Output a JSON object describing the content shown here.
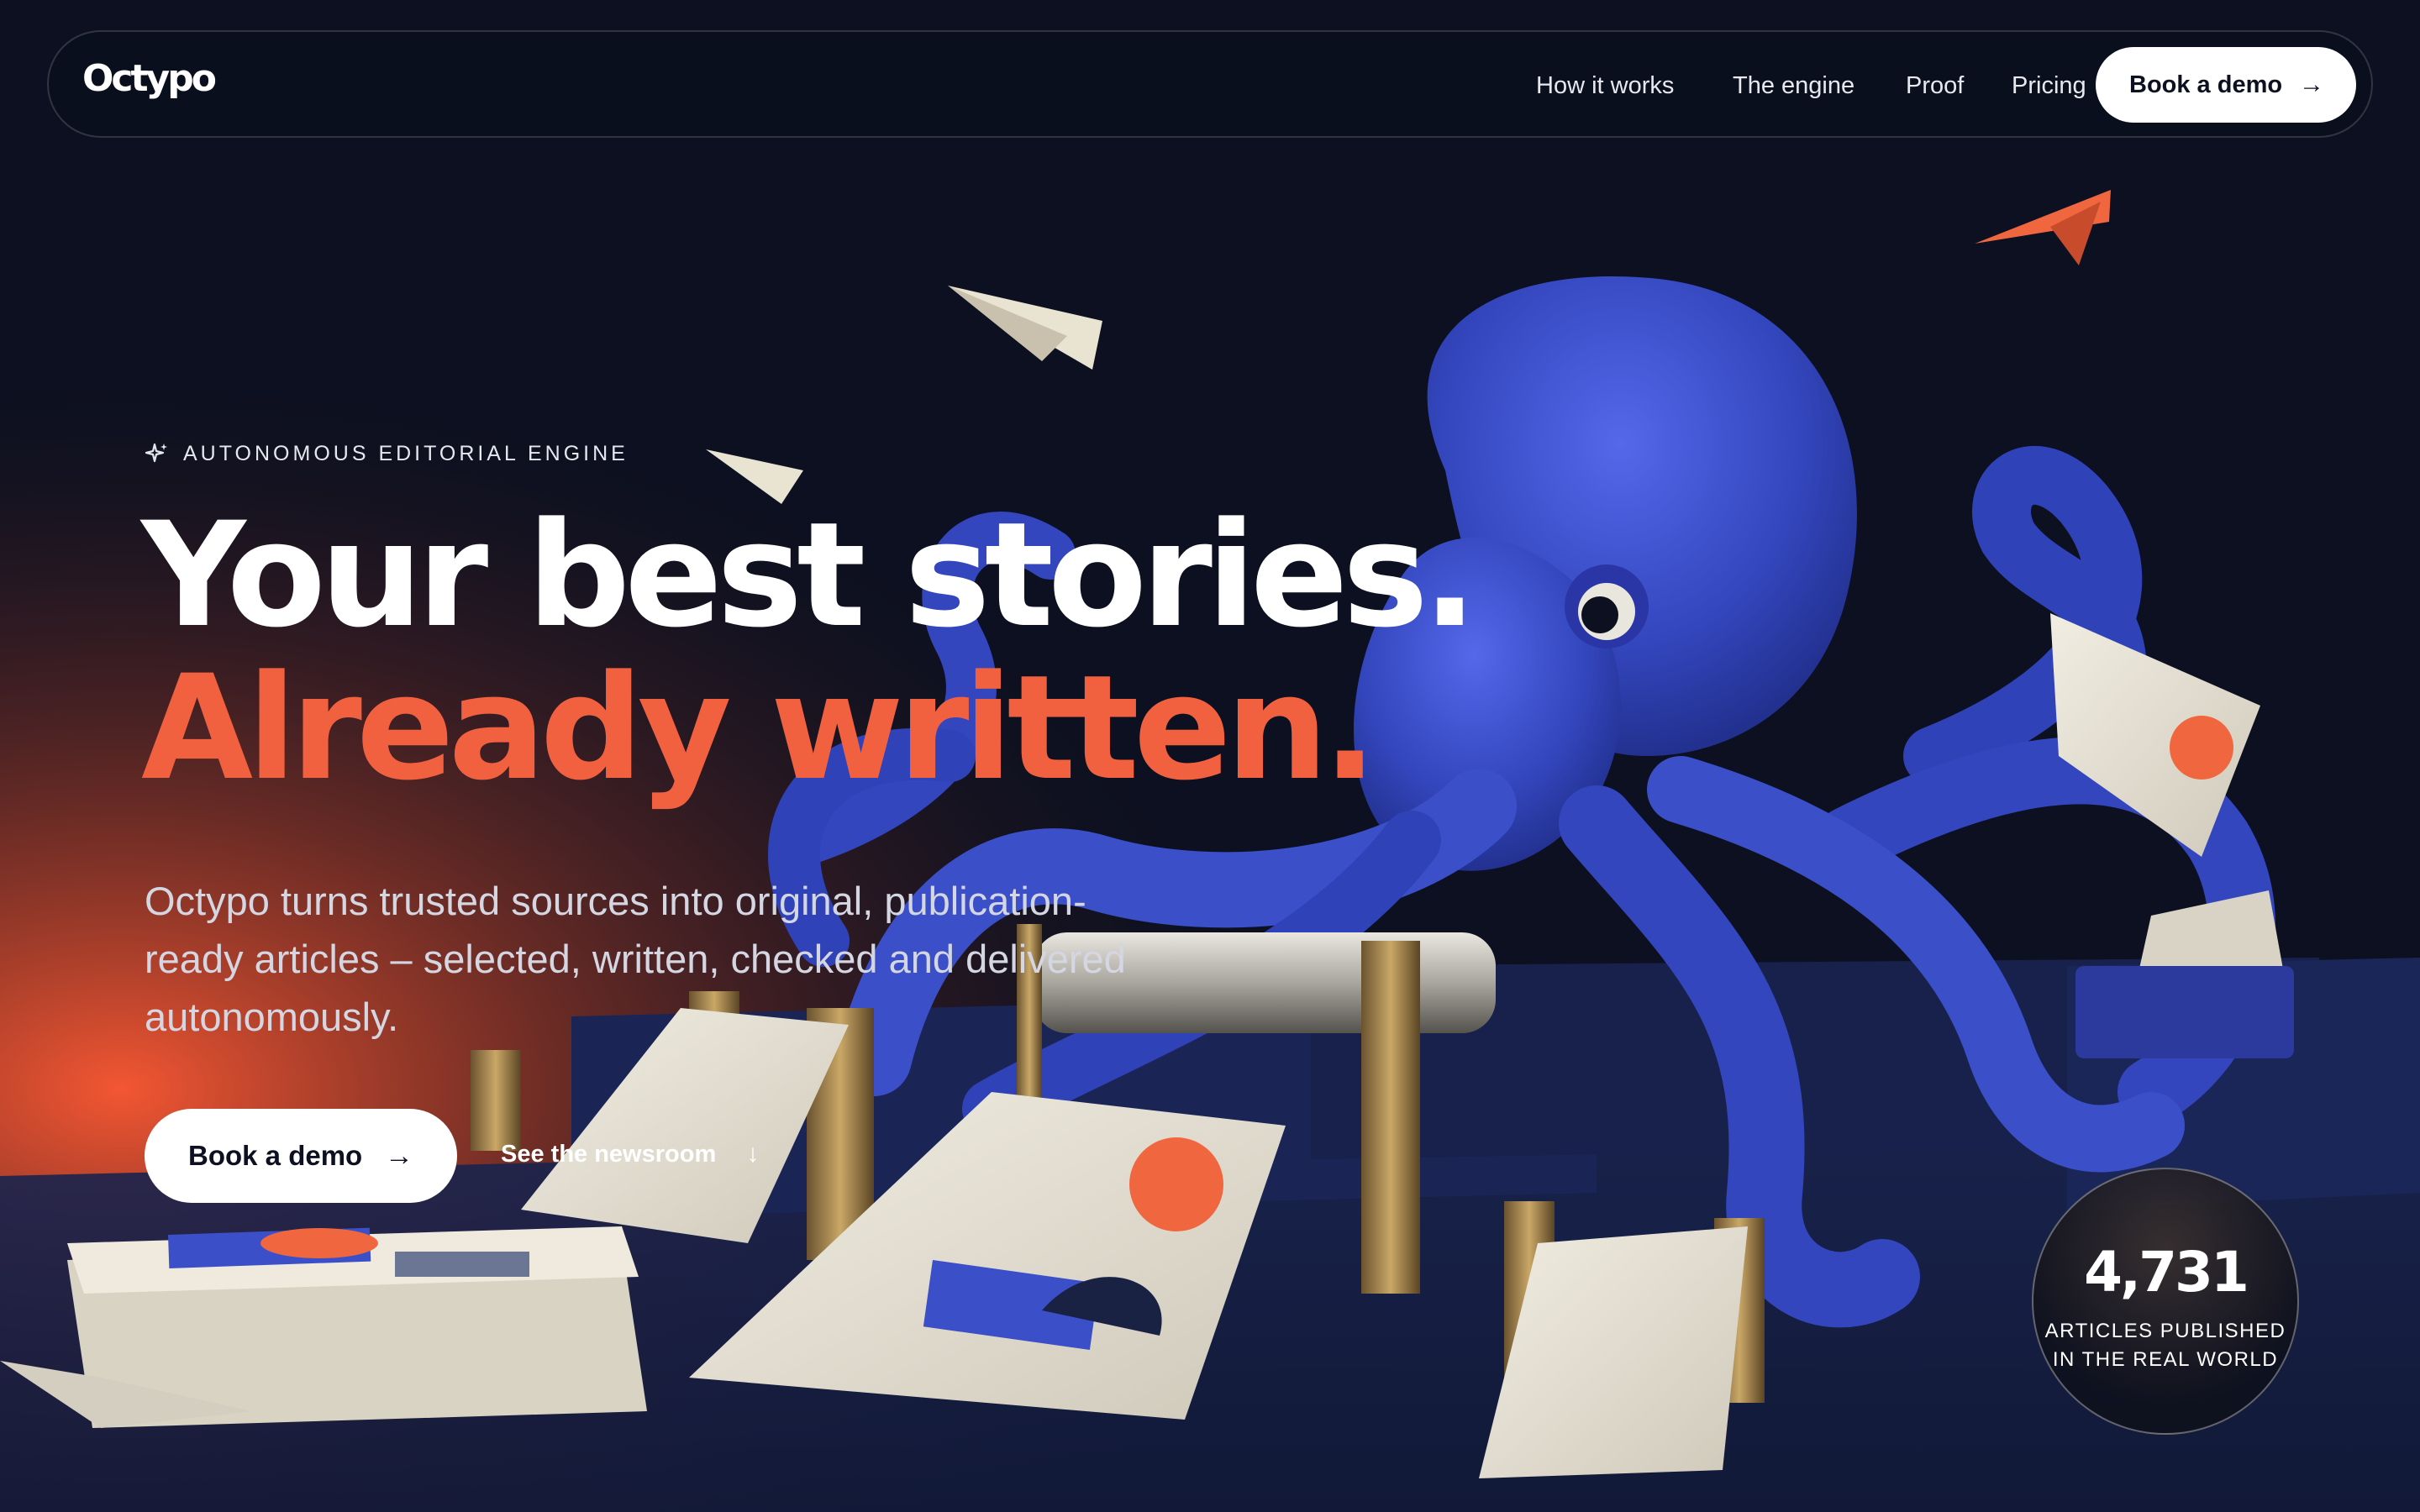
{
  "brand": {
    "logo": "Octypo"
  },
  "nav": {
    "links": [
      "How it works",
      "The engine",
      "Proof",
      "Pricing"
    ],
    "cta_label": "Book a demo",
    "cta_icon": "arrow-right-icon"
  },
  "hero": {
    "eyebrow_icon": "sparkle-icon",
    "eyebrow": "AUTONOMOUS EDITORIAL ENGINE",
    "headline_line1": "Your best stories.",
    "headline_line2": "Already written.",
    "subheadline": "Octypo turns trusted sources into original, publication-ready articles – selected, written, checked and delivered autonomously.",
    "primary_cta": "Book a demo",
    "secondary_cta": "See the newsroom",
    "secondary_cta_icon": "arrow-down-icon"
  },
  "stat": {
    "value": "4,731",
    "label_line1": "ARTICLES PUBLISHED",
    "label_line2": "IN THE REAL WORLD"
  },
  "colors": {
    "background": "#0c1020",
    "accent_orange": "#f2613f",
    "octopus_blue": "#3a4fc8",
    "text_white": "#ffffff"
  }
}
